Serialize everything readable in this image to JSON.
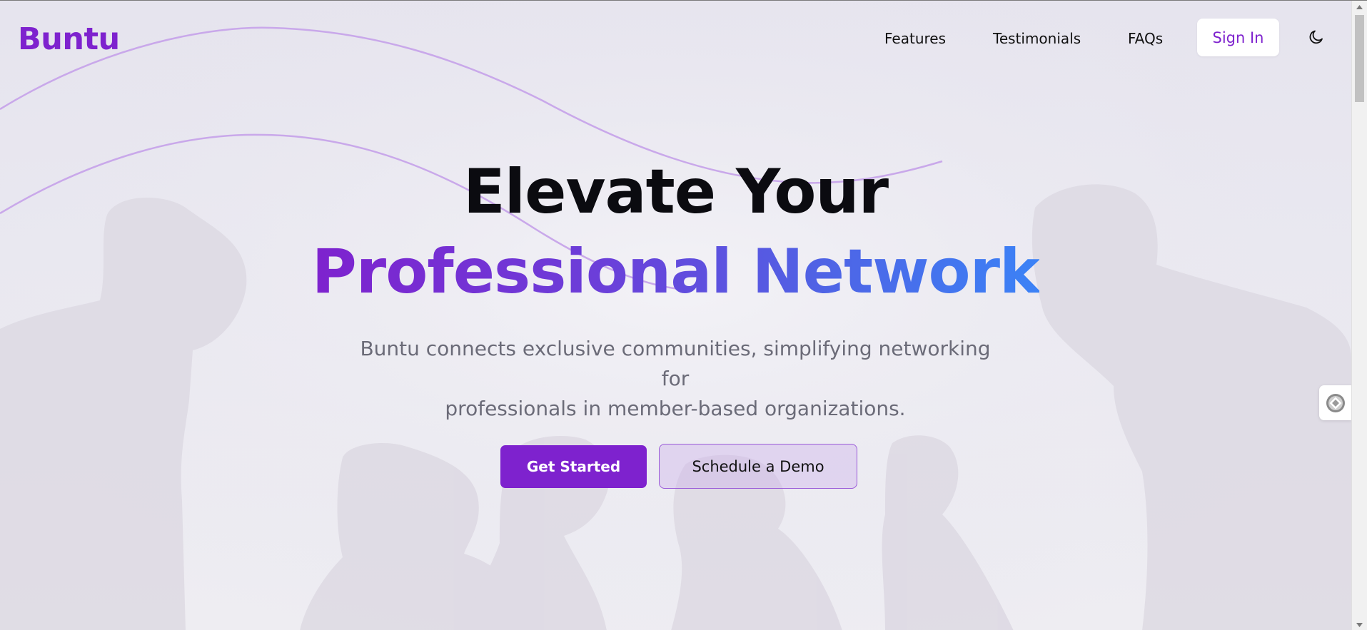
{
  "brand": {
    "name": "Buntu",
    "color": "#7e22ce"
  },
  "nav": {
    "links": [
      {
        "label": "Features"
      },
      {
        "label": "Testimonials"
      },
      {
        "label": "FAQs"
      }
    ],
    "signin_label": "Sign In",
    "theme_icon": "moon-icon"
  },
  "hero": {
    "title_line1": "Elevate Your",
    "title_line2": "Professional Network",
    "subtitle_line1": "Buntu connects exclusive communities, simplifying networking for",
    "subtitle_line2": "professionals in member-based organizations.",
    "primary_cta": "Get Started",
    "secondary_cta": "Schedule a Demo"
  },
  "colors": {
    "accent": "#7e22ce",
    "gradient_start": "#7e22ce",
    "gradient_end": "#3b82f6",
    "background": "#e8e7ef"
  },
  "side_widget": {
    "icon": "extension-widget-icon"
  },
  "scrollbar": {
    "icons": [
      "scroll-up-arrow-icon",
      "scroll-down-arrow-icon"
    ]
  }
}
